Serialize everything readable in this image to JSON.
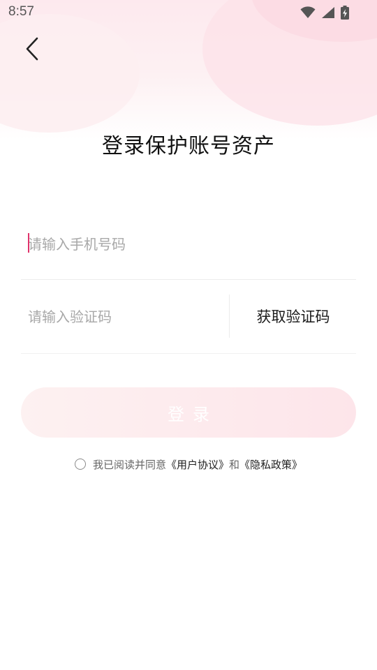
{
  "status_bar": {
    "time": "8:57",
    "icons": [
      "wifi-icon",
      "signal-icon",
      "battery-charging-icon"
    ]
  },
  "nav": {
    "back_icon": "chevron-left-icon"
  },
  "title": "登录保护账号资产",
  "phone": {
    "placeholder": "请输入手机号码",
    "value": ""
  },
  "code": {
    "placeholder": "请输入验证码",
    "value": "",
    "get_code_label": "获取验证码"
  },
  "login": {
    "label": "登录",
    "enabled": false
  },
  "agreement": {
    "checked": false,
    "prefix": "我已阅读并同意",
    "user_agreement": "《用户协议》",
    "and": "和",
    "privacy_policy": "《隐私政策》"
  },
  "colors": {
    "accent": "#e0336b",
    "login_button_start": "#fdf1f1",
    "login_button_end": "#fde5ea",
    "header_tint": "#fde9ee"
  }
}
